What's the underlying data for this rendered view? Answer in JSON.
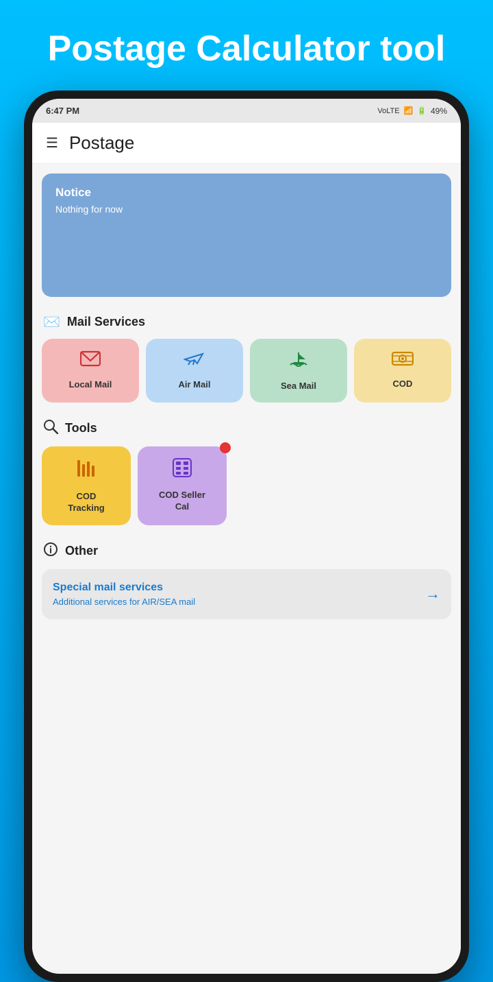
{
  "background": {
    "gradient_start": "#00bfff",
    "gradient_end": "#0099e6"
  },
  "header": {
    "title": "Postage\nCalculator tool"
  },
  "statusBar": {
    "time": "6:47 PM",
    "network": "VoLTE",
    "signal": "▐▌",
    "battery": "49%"
  },
  "appBar": {
    "menu_icon": "☰",
    "title": "Postage"
  },
  "notice": {
    "title": "Notice",
    "body": "Nothing for now"
  },
  "mailServices": {
    "section_title": "Mail Services",
    "section_icon": "✉",
    "items": [
      {
        "id": "local-mail",
        "label": "Local Mail",
        "icon": "✉",
        "color_class": "service-card-local",
        "icon_class": "service-icon-local"
      },
      {
        "id": "air-mail",
        "label": "Air Mail",
        "icon": "✈",
        "color_class": "service-card-air",
        "icon_class": "service-icon-air"
      },
      {
        "id": "sea-mail",
        "label": "Sea Mail",
        "icon": "🚢",
        "color_class": "service-card-sea",
        "icon_class": "service-icon-sea"
      },
      {
        "id": "cod",
        "label": "COD",
        "icon": "💳",
        "color_class": "service-card-cod",
        "icon_class": "service-icon-cod"
      }
    ]
  },
  "tools": {
    "section_title": "Tools",
    "section_icon": "🔍",
    "items": [
      {
        "id": "cod-tracking",
        "label": "COD\nTracking",
        "icon": "▌▌▌",
        "color_class": "tool-card-cod",
        "icon_class": "tool-icon-cod",
        "has_badge": false
      },
      {
        "id": "cod-seller-cal",
        "label": "COD Seller\nCal",
        "icon": "🧮",
        "color_class": "tool-card-seller",
        "icon_class": "tool-icon-seller",
        "has_badge": true
      }
    ]
  },
  "other": {
    "section_title": "Other",
    "section_icon": "ℹ",
    "card": {
      "title": "Special mail services",
      "subtitle": "Additional services for AIR/SEA mail",
      "arrow": "→"
    }
  }
}
